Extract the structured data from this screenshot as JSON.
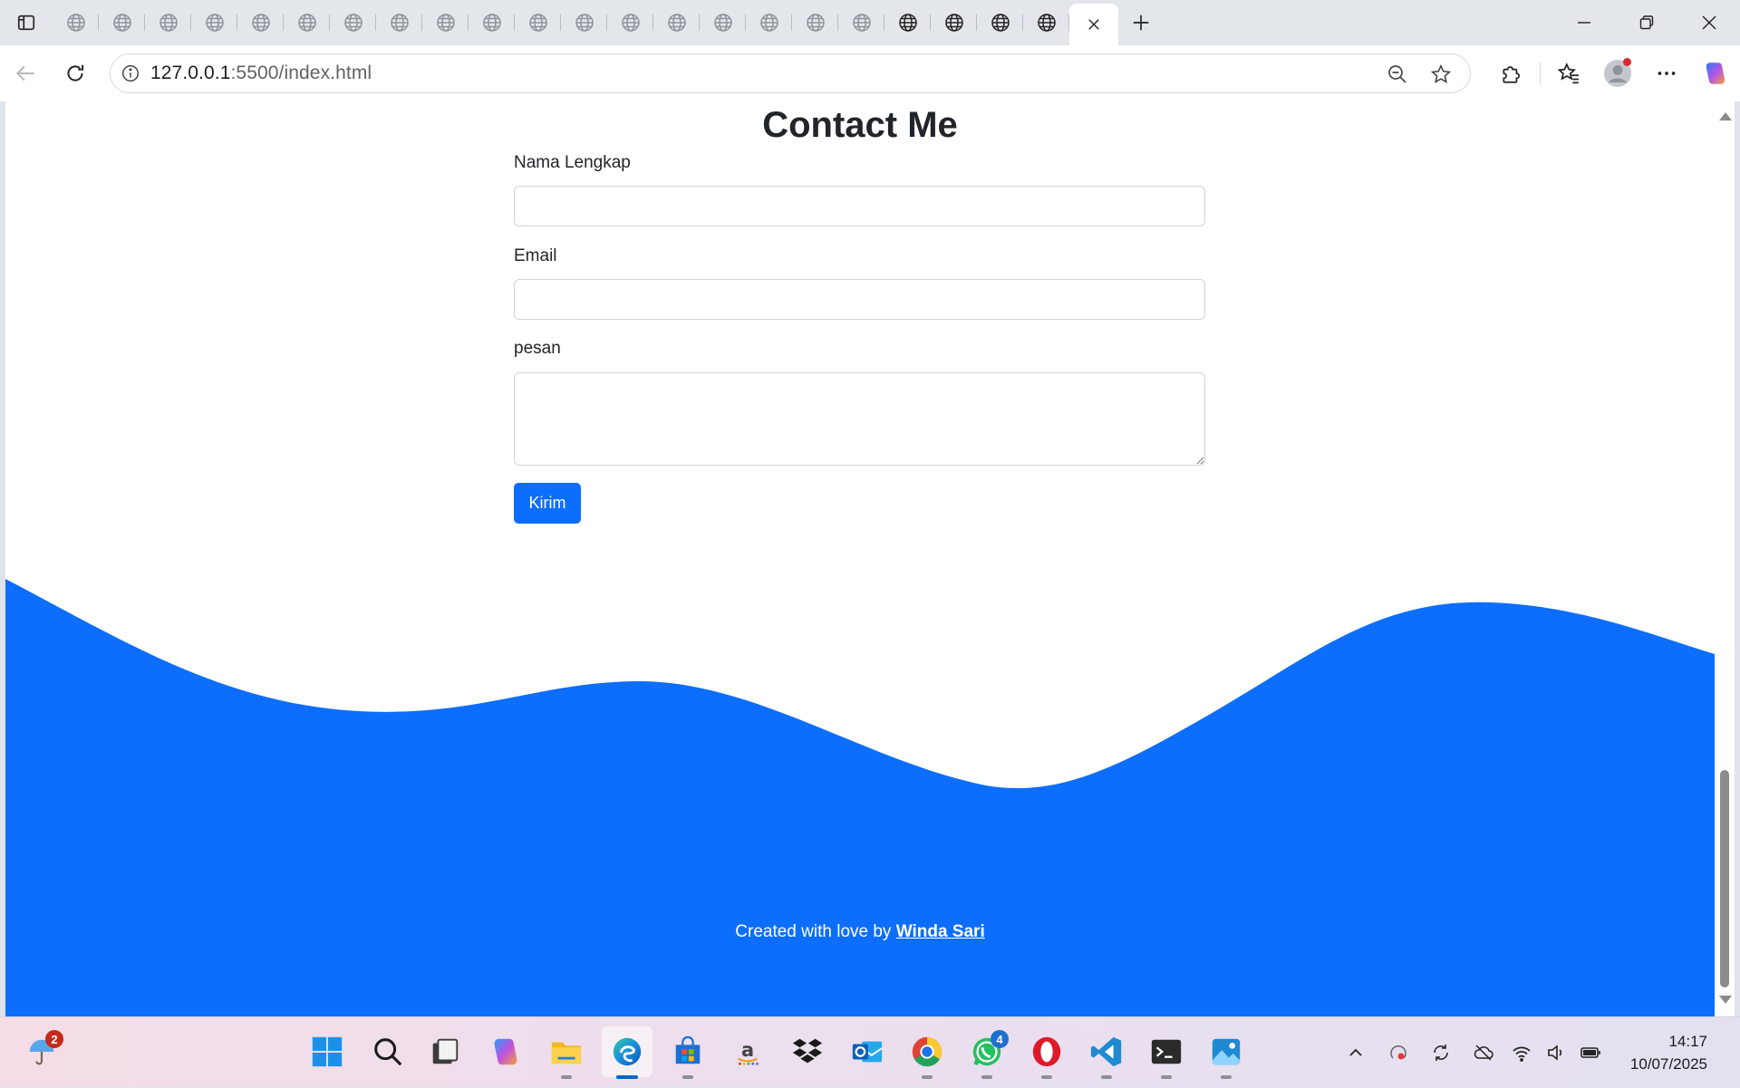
{
  "browser": {
    "url_host": "127.0.0.1",
    "url_rest": ":5500/index.html",
    "tab_count_globe": 22,
    "accent": "#0067c0"
  },
  "page": {
    "title": "Contact Me",
    "fields": {
      "name_label": "Nama Lengkap",
      "email_label": "Email",
      "message_label": "pesan",
      "name_value": "",
      "email_value": "",
      "message_value": ""
    },
    "submit_label": "Kirim",
    "footer_prefix": "Created with love by ",
    "footer_author": "Winda Sari",
    "primary_color": "#0d6efd"
  },
  "taskbar": {
    "weather_badge": "2",
    "whatsapp_badge": "4",
    "time": "14:17",
    "date": "10/07/2025"
  }
}
